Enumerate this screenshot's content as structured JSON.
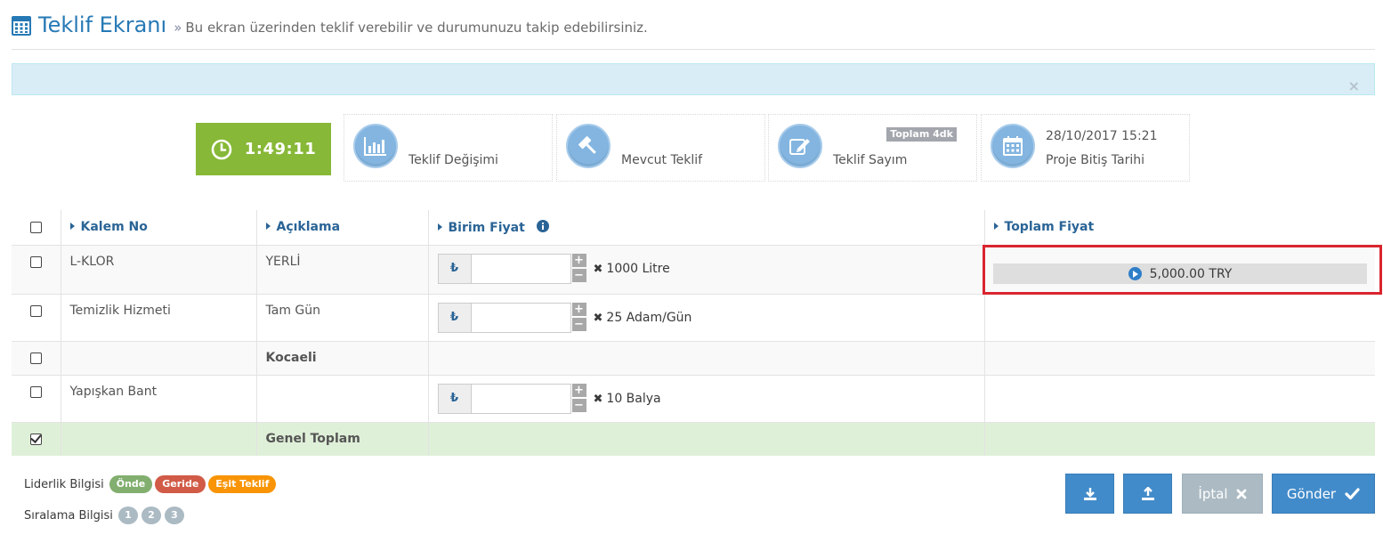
{
  "header": {
    "title": "Teklif Ekranı",
    "separator": "»",
    "subtitle": "Bu ekran üzerinden teklif verebilir ve durumunuzu takip edebilirsiniz.",
    "icon": "calculator-icon"
  },
  "alert": {
    "close_glyph": "×"
  },
  "timer": {
    "value": "1:49:11",
    "icon": "clock-icon"
  },
  "info_boxes": [
    {
      "label": "Teklif Değişimi",
      "icon": "bar-chart-icon"
    },
    {
      "label": "Mevcut Teklif",
      "icon": "gavel-icon"
    },
    {
      "label": "Teklif Sayım",
      "icon": "edit-icon",
      "tag": "Toplam 4dk"
    },
    {
      "value": "28/10/2017 15:21",
      "label": "Proje Bitiş Tarihi",
      "icon": "calendar-icon"
    }
  ],
  "table": {
    "columns": [
      "Kalem No",
      "Açıklama",
      "Birim Fiyat",
      "Toplam Fiyat"
    ],
    "currency_symbol": "₺",
    "rows": [
      {
        "kalem": "L-KLOR",
        "aciklama": "YERLİ",
        "qty": "1000 Litre",
        "total": "5,000.00 TRY"
      },
      {
        "kalem": "Temizlik Hizmeti",
        "aciklama": "Tam Gün",
        "qty": "25 Adam/Gün"
      },
      {
        "kalem": "",
        "aciklama": "Kocaeli"
      },
      {
        "kalem": "Yapışkan Bant",
        "aciklama": "",
        "qty": "10 Balya"
      },
      {
        "kalem": "",
        "aciklama": "Genel Toplam"
      }
    ]
  },
  "legend": {
    "liderlik_label": "Liderlik Bilgisi",
    "badges": [
      "Önde",
      "Geride",
      "Eşit Teklif"
    ],
    "siralama_label": "Sıralama Bilgisi",
    "ranks": [
      "1",
      "2",
      "3"
    ]
  },
  "buttons": {
    "iptal": "İptal",
    "gonder": "Gönder"
  },
  "colors": {
    "primary": "#428bca",
    "success": "#87b837",
    "highlight": "#d9252f"
  }
}
